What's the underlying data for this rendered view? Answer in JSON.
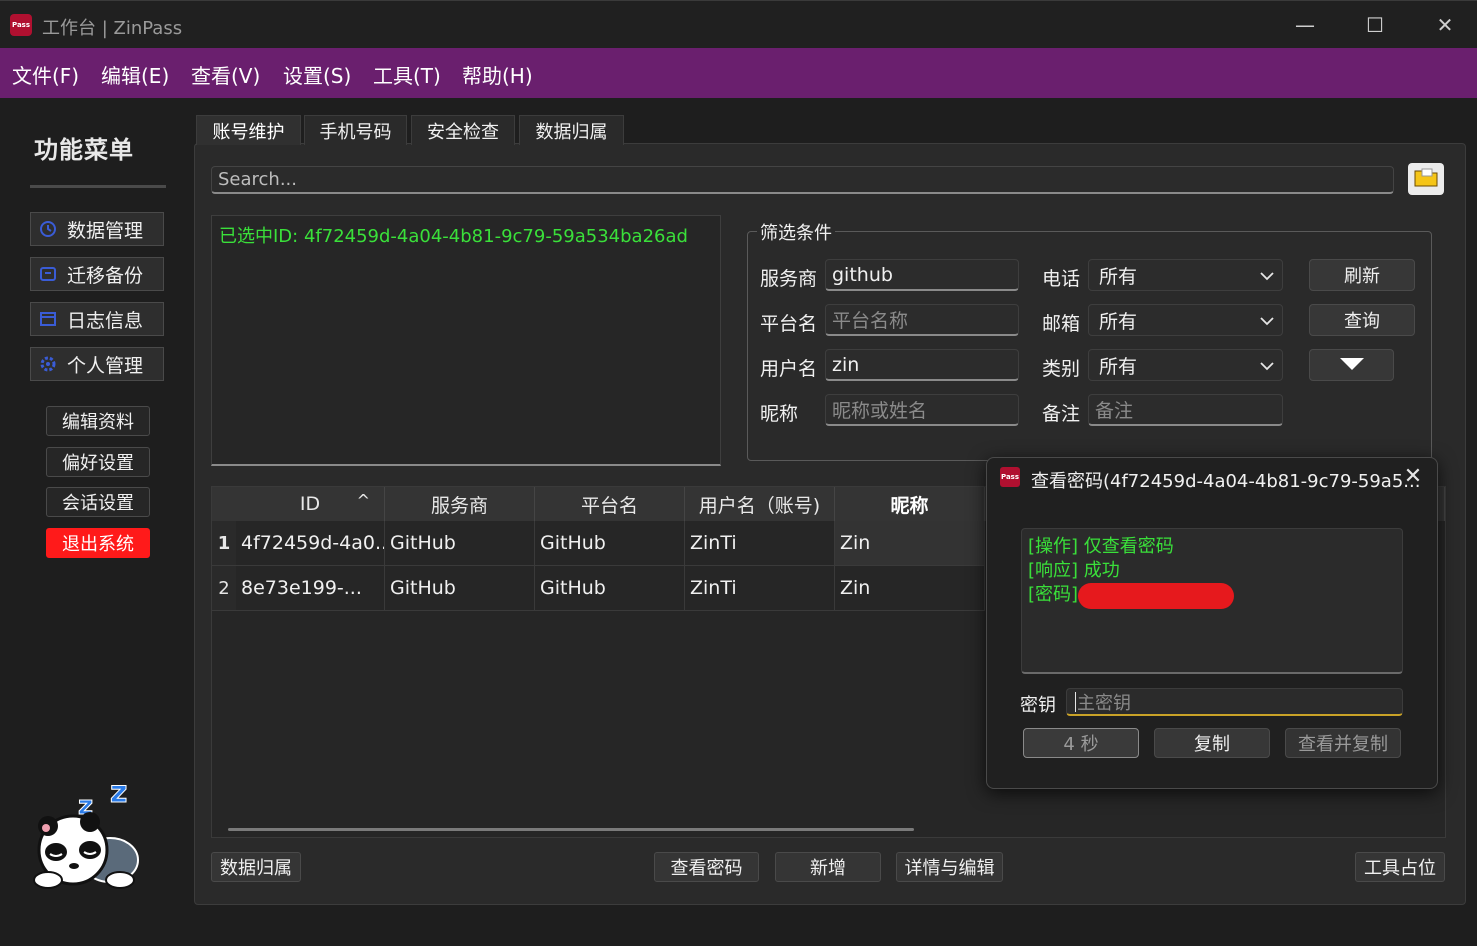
{
  "window": {
    "app_icon_text": "Pass",
    "title": "工作台 | ZinPass",
    "min": "—",
    "max": "☐",
    "close": "✕"
  },
  "menubar": [
    "文件(F)",
    "编辑(E)",
    "查看(V)",
    "设置(S)",
    "工具(T)",
    "帮助(H)"
  ],
  "sidebar": {
    "title": "功能菜单",
    "nav": [
      "数据管理",
      "迁移备份",
      "日志信息",
      "个人管理"
    ],
    "sub": [
      "编辑资料",
      "偏好设置",
      "会话设置",
      "退出系统"
    ]
  },
  "tabs": [
    "账号维护",
    "手机号码",
    "安全检查",
    "数据归属"
  ],
  "search": {
    "placeholder": "Search..."
  },
  "selected_id_text": "已选中ID: 4f72459d-4a04-4b81-9c79-59a534ba26ad",
  "filter": {
    "legend": "筛选条件",
    "fields": {
      "provider_label": "服务商",
      "provider_value": "github",
      "platform_label": "平台名",
      "platform_placeholder": "平台名称",
      "username_label": "用户名",
      "username_value": "zin",
      "nickname_label": "昵称",
      "nickname_placeholder": "昵称或姓名",
      "phone_label": "电话",
      "phone_value": "所有",
      "email_label": "邮箱",
      "email_value": "所有",
      "category_label": "类别",
      "category_value": "所有",
      "note_label": "备注",
      "note_placeholder": "备注"
    },
    "refresh_button": "刷新",
    "query_button": "查询"
  },
  "table": {
    "headers": [
      "ID",
      "服务商",
      "平台名",
      "用户名（账号)",
      "昵称"
    ],
    "sort_indicator": "^",
    "rows": [
      {
        "num": "1",
        "cells": [
          "4f72459d-4a0...",
          "GitHub",
          "GitHub",
          "ZinTi",
          "Zin"
        ]
      },
      {
        "num": "2",
        "cells": [
          "8e73e199-...",
          "GitHub",
          "GitHub",
          "ZinTi",
          "Zin"
        ]
      }
    ]
  },
  "bottom_buttons": {
    "data_owner": "数据归属",
    "view_password": "查看密码",
    "add": "新增",
    "detail_edit": "详情与编辑",
    "tool_placeholder": "工具占位"
  },
  "dialog": {
    "icon_text": "Pass",
    "title": "查看密码(4f72459d-4a04-4b81-9c79-59a5...",
    "close": "✕",
    "log_lines": [
      "[操作] 仅查看密码",
      "[响应] 成功",
      "[密码]"
    ],
    "key_label": "密钥",
    "key_placeholder": "主密钥",
    "countdown_button": "4 秒",
    "copy_button": "复制",
    "view_copy_button": "查看并复制"
  },
  "colors": {
    "menubar": "#6a1f6e",
    "accent_green": "#3ae03a",
    "logout_red": "#ff1a1a",
    "redaction": "#e6191d"
  }
}
